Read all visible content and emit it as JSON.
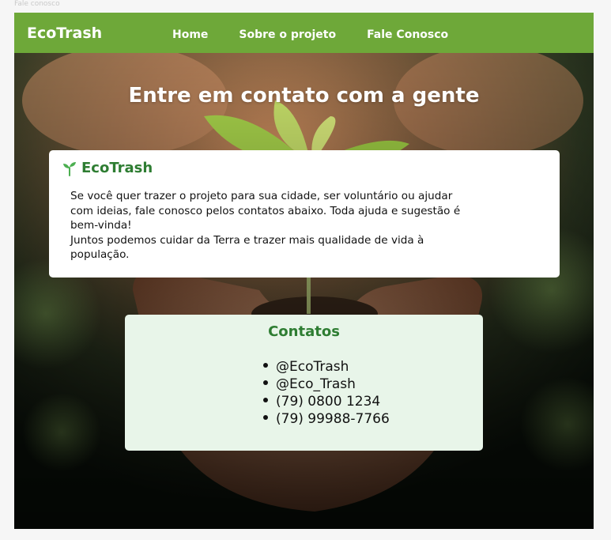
{
  "tab_label": "Fale conosco",
  "navbar": {
    "brand": "EcoTrash",
    "links": [
      "Home",
      "Sobre o projeto",
      "Fale Conosco"
    ]
  },
  "hero": {
    "title": "Entre em contato com a gente"
  },
  "about": {
    "icon": "sprout-icon",
    "title": "EcoTrash",
    "paragraph1": "Se você quer trazer o projeto para sua cidade, ser voluntário ou ajudar com ideias, fale conosco pelos contatos abaixo. Toda ajuda e sugestão é bem-vinda!",
    "paragraph2": "Juntos podemos cuidar da Terra e trazer mais qualidade de vida à população."
  },
  "contacts": {
    "title": "Contatos",
    "items": [
      "@EcoTrash",
      "@Eco_Trash",
      "(79) 0800 1234",
      "(79) 99988-7766"
    ]
  },
  "colors": {
    "navbar": "#6ea839",
    "accent_green": "#2e7d32",
    "contacts_bg": "#e8f5e9"
  }
}
